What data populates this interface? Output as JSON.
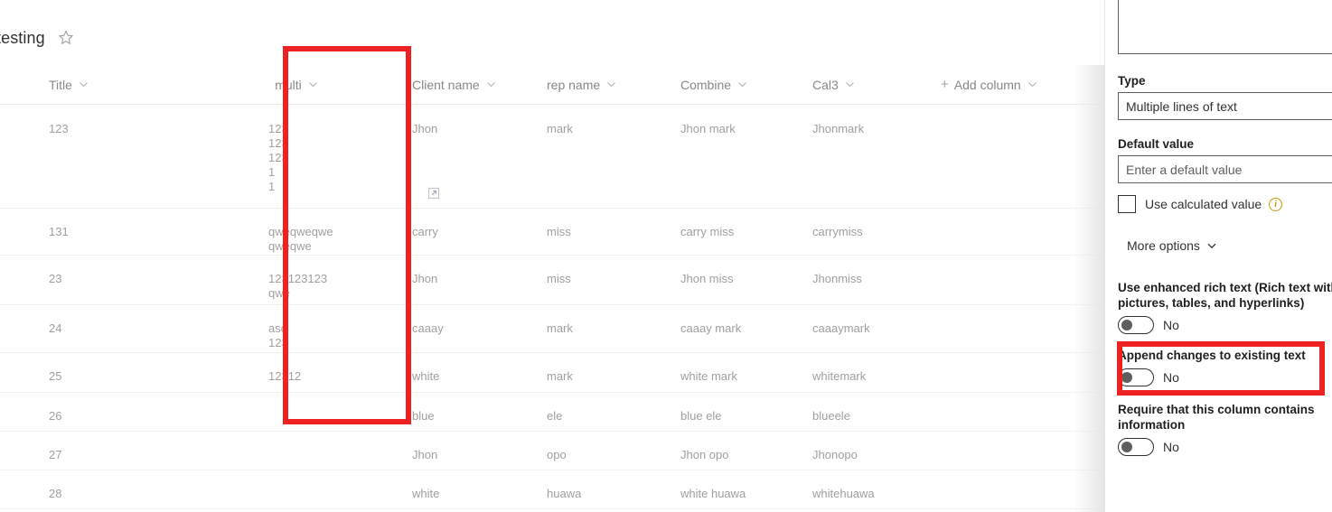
{
  "list": {
    "title": "testing",
    "favorite_icon": "star-icon",
    "open_item_icon": "open-in-new-icon",
    "columns": [
      {
        "label": "Title",
        "sort_icon": "chevron-down-icon"
      },
      {
        "label": "multi",
        "sort_icon": "chevron-down-icon"
      },
      {
        "label": "Client name",
        "sort_icon": "chevron-down-icon"
      },
      {
        "label": "rep name",
        "sort_icon": "chevron-down-icon"
      },
      {
        "label": "Combine",
        "sort_icon": "chevron-down-icon"
      },
      {
        "label": "Cal3",
        "sort_icon": "chevron-down-icon"
      }
    ],
    "add_column": {
      "plus": "+",
      "label": "Add column",
      "chevron": "chevron-down-icon"
    },
    "rows": [
      {
        "title": "123",
        "multi": "123\n123\n123\n1\n1",
        "client": "Jhon",
        "rep": "mark",
        "combine": "Jhon mark",
        "cal3": "Jhonmark"
      },
      {
        "title": "131",
        "multi": "qweqweqwe\nqweqwe",
        "client": "carry",
        "rep": "miss",
        "combine": "carry miss",
        "cal3": "carrymiss"
      },
      {
        "title": "23",
        "multi": "123123123\nqwe",
        "client": "Jhon",
        "rep": "miss",
        "combine": "Jhon miss",
        "cal3": "Jhonmiss"
      },
      {
        "title": "24",
        "multi": "asd\n123",
        "client": "caaay",
        "rep": "mark",
        "combine": "caaay mark",
        "cal3": "caaaymark"
      },
      {
        "title": "25",
        "multi": "12312",
        "client": "white",
        "rep": "mark",
        "combine": "white mark",
        "cal3": "whitemark"
      },
      {
        "title": "26",
        "multi": "",
        "client": "blue",
        "rep": "ele",
        "combine": "blue ele",
        "cal3": "blueele"
      },
      {
        "title": "27",
        "multi": "",
        "client": "Jhon",
        "rep": "opo",
        "combine": "Jhon opo",
        "cal3": "Jhonopo"
      },
      {
        "title": "28",
        "multi": "",
        "client": "white",
        "rep": "huawa",
        "combine": "white huawa",
        "cal3": "whitehuawa"
      }
    ]
  },
  "panel": {
    "description_value": "",
    "type": {
      "label": "Type",
      "value": "Multiple lines of text"
    },
    "default_value": {
      "label": "Default value",
      "placeholder": "Enter a default value"
    },
    "use_calculated_value": {
      "label": "Use calculated value",
      "checked": false,
      "info_icon": "info-icon",
      "info_glyph": "i"
    },
    "more_options": {
      "label": "More options",
      "chevron": "chevron-down-icon"
    },
    "options": [
      {
        "label": "Use enhanced rich text (Rich text with pictures, tables, and hyperlinks)",
        "state": "No"
      },
      {
        "label": "Append changes to existing text",
        "state": "No"
      },
      {
        "label": "Require that this column contains information",
        "state": "No"
      }
    ]
  },
  "annotations": {
    "highlight_color": "#ee2222",
    "boxes": [
      {
        "name": "multi-column-highlight"
      },
      {
        "name": "append-changes-highlight"
      }
    ]
  }
}
